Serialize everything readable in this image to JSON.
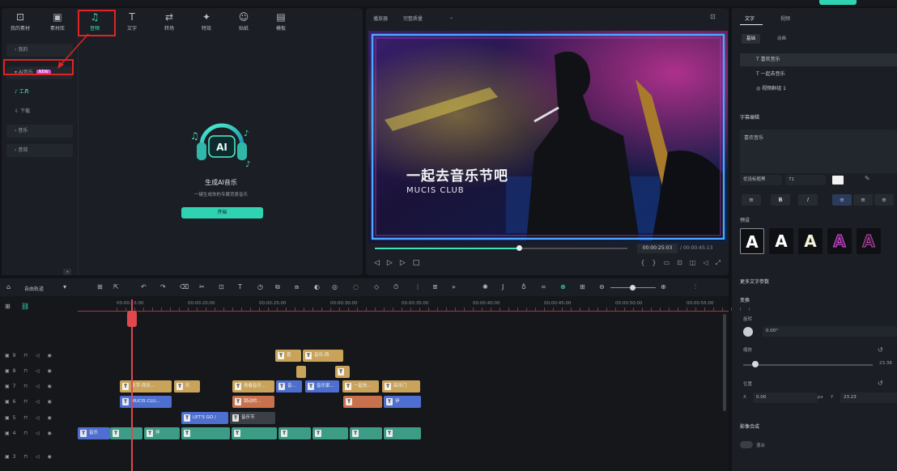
{
  "topbar": {
    "app_title": "",
    "project_title": ""
  },
  "library": {
    "tabs": [
      {
        "label": "我的素材",
        "icon": "media-icon"
      },
      {
        "label": "素材库",
        "icon": "library-icon"
      },
      {
        "label": "音频",
        "icon": "music-icon"
      },
      {
        "label": "文字",
        "icon": "text-icon"
      },
      {
        "label": "转场",
        "icon": "transition-icon"
      },
      {
        "label": "特效",
        "icon": "effects-icon"
      },
      {
        "label": "贴纸",
        "icon": "sticker-icon"
      },
      {
        "label": "模板",
        "icon": "template-icon"
      }
    ],
    "side": {
      "item1": "我的",
      "ai": "AI音乐",
      "new_badge": "NEW",
      "tools": "工具",
      "download": "下载",
      "item4": "音乐",
      "item5": "音效"
    },
    "ai_card": {
      "title": "生成AI音乐",
      "desc": "一键生成你的专属背景音乐",
      "start": "开始"
    }
  },
  "preview": {
    "mode": "播放器",
    "quality": "完整质量",
    "video_title": "一起去音乐节吧",
    "video_sub": "MUCIS CLUB",
    "progress": 0.57,
    "time_current": "00:00:25:03",
    "time_total": "00:00:45:13"
  },
  "inspector": {
    "tab_text": "文字",
    "tab_other": "视频",
    "sub_basic": "基础",
    "sub_anim": "动画",
    "layers": [
      "喜欢音乐",
      "一起去音乐",
      "视频群组 1"
    ],
    "section_text": "字幕编辑",
    "text_value": "喜欢音乐",
    "font_value": "优设标题黑",
    "size_value": "71",
    "presets_label": "预设",
    "advanced": "更多文字参数",
    "transform": "变换",
    "rotate_label": "旋转",
    "rotate_value": "0.00°",
    "scale_label": "缩放",
    "scale_value": "23.38",
    "pos_label": "位置",
    "pos_x": "0.00",
    "pos_unit": "px",
    "pos_y": "23.23",
    "compositing": "影像合成",
    "blend": "混合",
    "x_label": "X",
    "y_label": "Y"
  },
  "timeline": {
    "mode_label": "自由轨道",
    "timecodes": [
      "00:00:15:00",
      "00:00:20:00",
      "00:00:25:00",
      "00:00:30:00",
      "00:00:35:00",
      "00:00:40:00",
      "00:00:45:00",
      "00:00:50:00",
      "00:00:55:00",
      "00:01:00:00"
    ],
    "tracks": [
      "9",
      "8",
      "7",
      "6",
      "5",
      "4",
      "3"
    ],
    "clips": {
      "r1a": "喜",
      "r1b": "音乐-西",
      "r3a": "文字-西乐...",
      "r3b": "乐",
      "r3c": "青春音乐...",
      "r3d": "音...",
      "r3e": "音乐家...",
      "r3f": "一起去...",
      "r3g": "高乐门",
      "r4a": "MUCIS CLU...",
      "r4b": "跳动的...",
      "r4c": "伊",
      "r5a": "LET'S GO /",
      "r5b": "音乐节",
      "r6a": "音乐",
      "r6b": "伴"
    }
  }
}
